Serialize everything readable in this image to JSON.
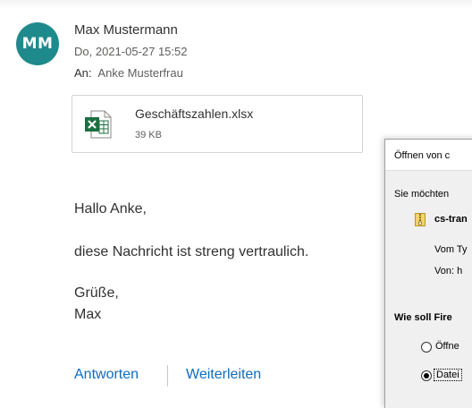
{
  "email": {
    "avatar_initials": "MM",
    "sender_name": "Max Mustermann",
    "date": "Do, 2021-05-27 15:52",
    "to_label": "An:",
    "recipient": "Anke Musterfrau",
    "attachment": {
      "icon": "excel-file-icon",
      "filename": "Geschäftszahlen.xlsx",
      "size": "39 KB"
    },
    "body": {
      "greeting": "Hallo Anke,",
      "line1": "diese Nachricht ist streng vertraulich.",
      "closing1": "Grüße,",
      "closing2": "Max"
    },
    "actions": {
      "reply": "Antworten",
      "forward": "Weiterleiten"
    },
    "colors": {
      "avatar_bg": "#1f8a8c",
      "link": "#0f6cbd",
      "excel_green": "#1d6f42"
    }
  },
  "dialog": {
    "title": "Öffnen von c",
    "intro": "Sie möchten",
    "file_icon": "zip-archive-icon",
    "filename": "cs-tran",
    "type_label": "Vom Ty",
    "from_label": "Von: h",
    "question": "Wie soll Fire",
    "option_open": "Öffne",
    "option_save": "Datei",
    "selected_option": "save"
  }
}
